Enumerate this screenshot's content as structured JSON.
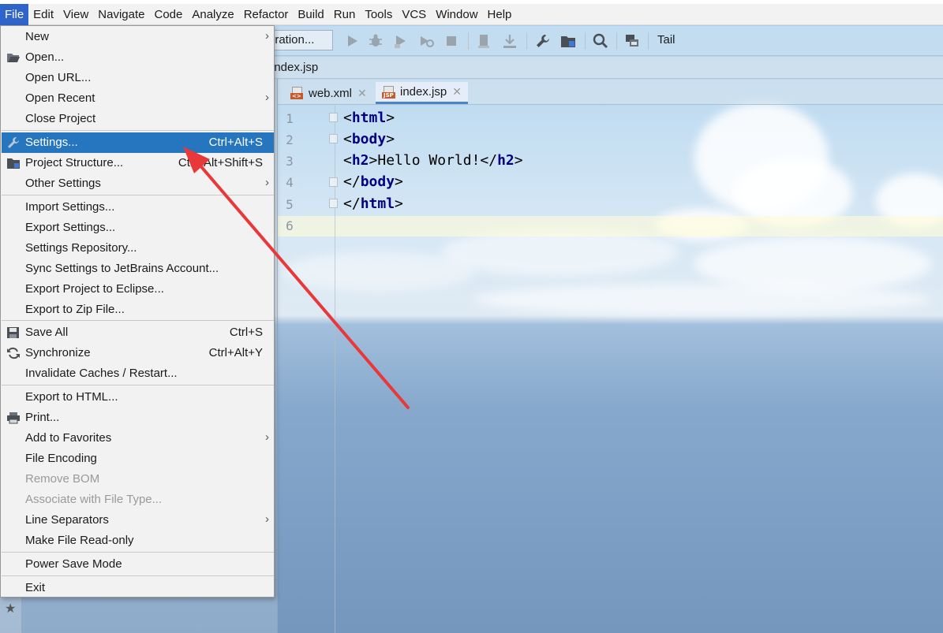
{
  "menubar": {
    "items": [
      "File",
      "Edit",
      "View",
      "Navigate",
      "Code",
      "Analyze",
      "Refactor",
      "Build",
      "Run",
      "Tools",
      "VCS",
      "Window",
      "Help"
    ]
  },
  "toolbar": {
    "run_config_label": "iration...",
    "tail_label": "Tail",
    "icons": [
      "run-icon",
      "debug-icon",
      "run-coverage-icon",
      "profile-icon",
      "stop-icon",
      "build-icon",
      "download-icon",
      "wrench-icon",
      "project-structure-icon",
      "search-icon",
      "terminal-icon"
    ]
  },
  "navbar": {
    "crumb": "index.jsp"
  },
  "editor": {
    "tabs": [
      {
        "label": "web.xml",
        "badge": "<>",
        "badge_color": "#c75a2c"
      },
      {
        "label": "index.jsp",
        "badge": "JSP",
        "badge_color": "#c75a2c"
      }
    ],
    "line_numbers": [
      "1",
      "2",
      "3",
      "4",
      "5",
      "6"
    ],
    "lines": [
      {
        "open": "<",
        "tag": "html",
        "close": ">",
        "rest": ""
      },
      {
        "open": "<",
        "tag": "body",
        "close": ">",
        "rest": ""
      },
      {
        "open": "<",
        "tag": "h2",
        "close": ">",
        "rest": "Hello World!</",
        "tag2": "h2",
        "close2": ">"
      },
      {
        "open": "</",
        "tag": "body",
        "close": ">",
        "rest": ""
      },
      {
        "open": "</",
        "tag": "html",
        "close": ">",
        "rest": ""
      }
    ]
  },
  "file_menu": {
    "items": [
      {
        "label": "New",
        "shortcut": "",
        "submenu": true,
        "icon": ""
      },
      {
        "label": "Open...",
        "shortcut": "",
        "submenu": false,
        "icon": "folder-open-icon"
      },
      {
        "label": "Open URL...",
        "shortcut": "",
        "submenu": false,
        "icon": ""
      },
      {
        "label": "Open Recent",
        "shortcut": "",
        "submenu": true,
        "icon": ""
      },
      {
        "label": "Close Project",
        "shortcut": "",
        "submenu": false,
        "icon": ""
      },
      {
        "label": "Settings...",
        "shortcut": "Ctrl+Alt+S",
        "submenu": false,
        "icon": "wrench-icon",
        "selected": true
      },
      {
        "label": "Project Structure...",
        "shortcut": "Ctrl+Alt+Shift+S",
        "submenu": false,
        "icon": "project-structure-icon"
      },
      {
        "label": "Other Settings",
        "shortcut": "",
        "submenu": true,
        "icon": ""
      },
      {
        "label": "Import Settings...",
        "shortcut": "",
        "submenu": false,
        "icon": ""
      },
      {
        "label": "Export Settings...",
        "shortcut": "",
        "submenu": false,
        "icon": ""
      },
      {
        "label": "Settings Repository...",
        "shortcut": "",
        "submenu": false,
        "icon": ""
      },
      {
        "label": "Sync Settings to JetBrains Account...",
        "shortcut": "",
        "submenu": false,
        "icon": ""
      },
      {
        "label": "Export Project to Eclipse...",
        "shortcut": "",
        "submenu": false,
        "icon": ""
      },
      {
        "label": "Export to Zip File...",
        "shortcut": "",
        "submenu": false,
        "icon": ""
      },
      {
        "label": "Save All",
        "shortcut": "Ctrl+S",
        "submenu": false,
        "icon": "save-icon"
      },
      {
        "label": "Synchronize",
        "shortcut": "Ctrl+Alt+Y",
        "submenu": false,
        "icon": "sync-icon"
      },
      {
        "label": "Invalidate Caches / Restart...",
        "shortcut": "",
        "submenu": false,
        "icon": ""
      },
      {
        "label": "Export to HTML...",
        "shortcut": "",
        "submenu": false,
        "icon": ""
      },
      {
        "label": "Print...",
        "shortcut": "",
        "submenu": false,
        "icon": "print-icon"
      },
      {
        "label": "Add to Favorites",
        "shortcut": "",
        "submenu": true,
        "icon": ""
      },
      {
        "label": "File Encoding",
        "shortcut": "",
        "submenu": false,
        "icon": ""
      },
      {
        "label": "Remove BOM",
        "shortcut": "",
        "submenu": false,
        "icon": "",
        "disabled": true
      },
      {
        "label": "Associate with File Type...",
        "shortcut": "",
        "submenu": false,
        "icon": "",
        "disabled": true
      },
      {
        "label": "Line Separators",
        "shortcut": "",
        "submenu": true,
        "icon": ""
      },
      {
        "label": "Make File Read-only",
        "shortcut": "",
        "submenu": false,
        "icon": ""
      },
      {
        "label": "Power Save Mode",
        "shortcut": "",
        "submenu": false,
        "icon": ""
      },
      {
        "label": "Exit",
        "shortcut": "",
        "submenu": false,
        "icon": ""
      }
    ]
  },
  "colors": {
    "menu_selected": "#2675bf",
    "menubar_active": "#2f65ca",
    "annotation_arrow": "#e8383a",
    "tag_color": "#000080"
  }
}
